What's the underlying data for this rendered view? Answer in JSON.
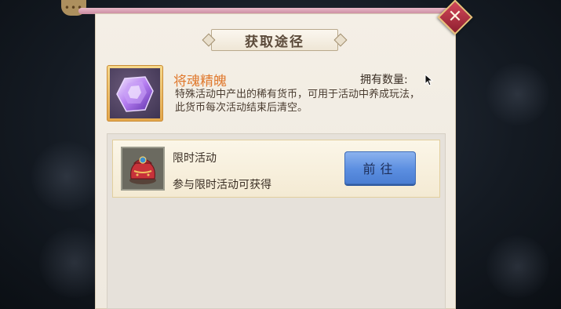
{
  "dialog": {
    "title": "获取途径",
    "close_icon": "close-x-icon"
  },
  "item": {
    "name": "将魂精魄",
    "own_label": "拥有数量:",
    "own_value": "",
    "description": "特殊活动中产出的稀有货币，可用于活动中养成玩法，此货币每次活动结束后清空。",
    "icon": "purple-gem-icon"
  },
  "sources": [
    {
      "title": "限时活动",
      "description": "参与限时活动可获得",
      "button_label": "前往",
      "icon": "red-bag-icon"
    }
  ],
  "colors": {
    "item_name": "#e07a2f",
    "goto_button": "#5b8ee0",
    "close_button": "#b8323f"
  }
}
